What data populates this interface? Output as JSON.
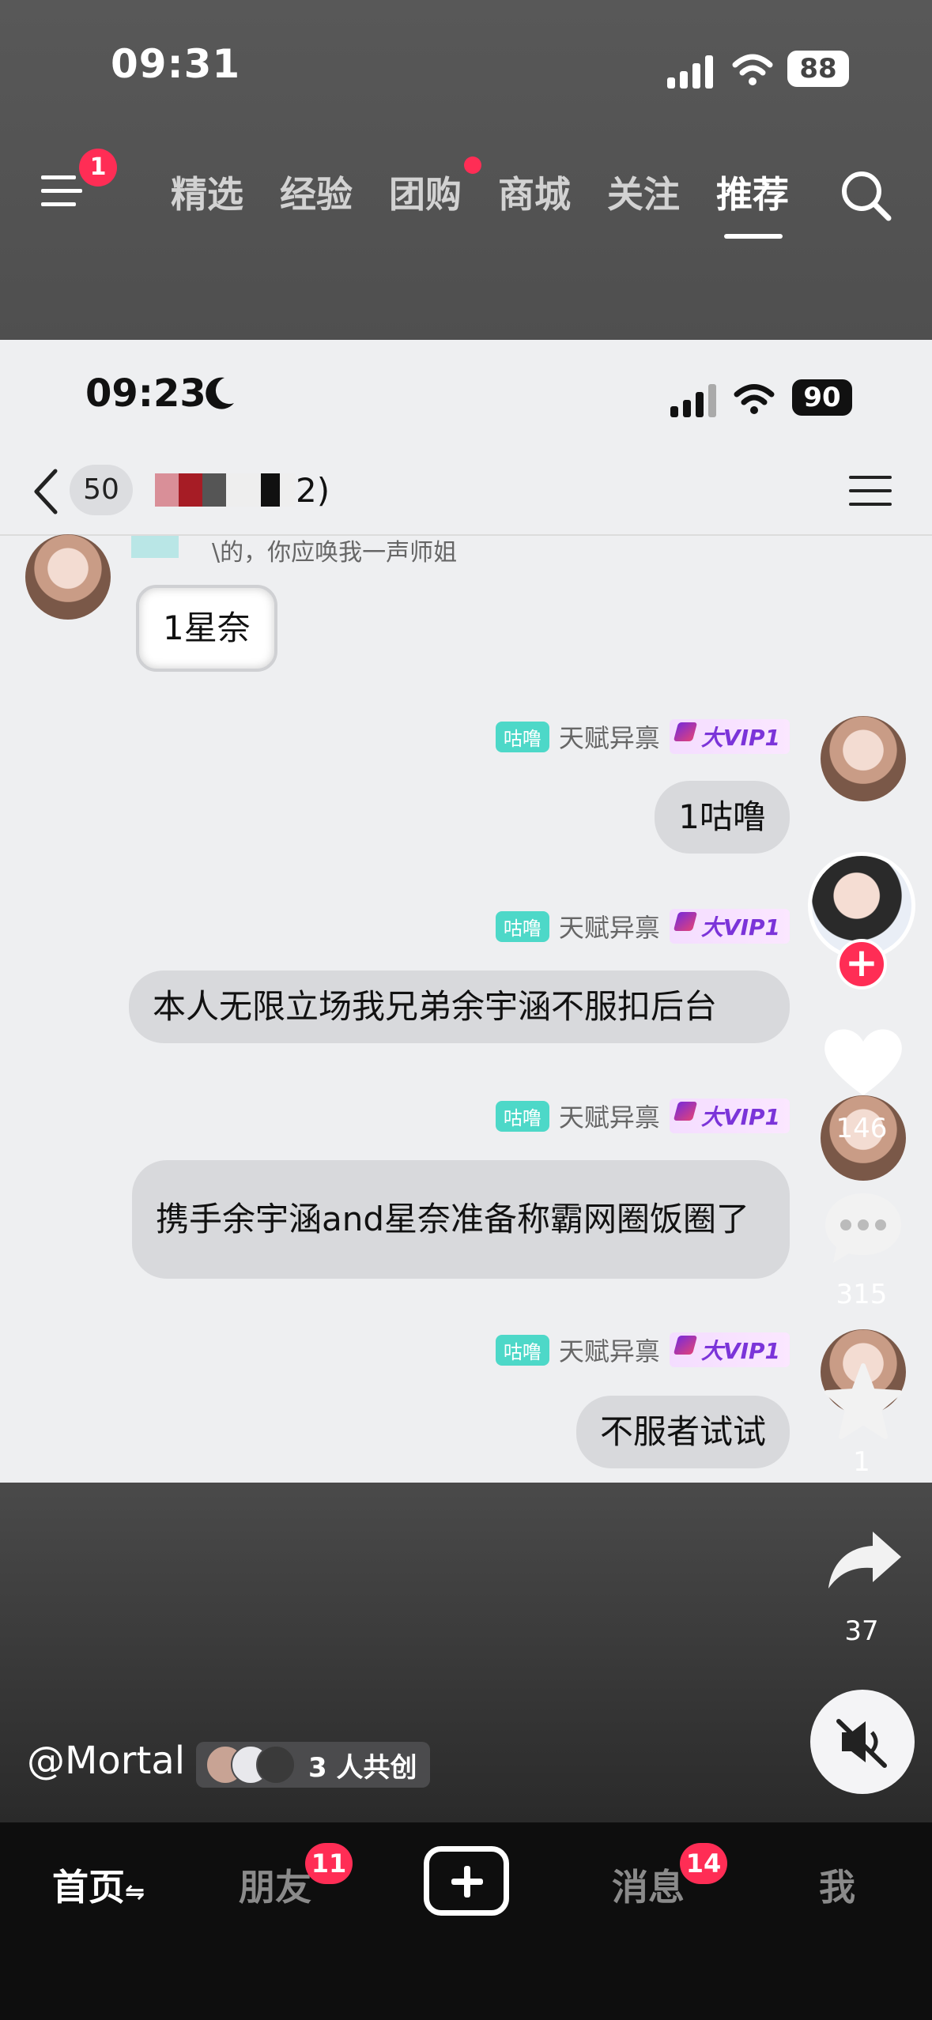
{
  "outer_status": {
    "time": "09:31",
    "battery": "88"
  },
  "top_nav": {
    "menu_badge": "1",
    "tabs": [
      "精选",
      "经验",
      "团购",
      "商城",
      "关注",
      "推荐"
    ],
    "active_tab": "推荐"
  },
  "inner_status": {
    "time": "09:23",
    "battery": "90"
  },
  "chat_header": {
    "unread": "50",
    "title_suffix": "2)"
  },
  "messages": [
    {
      "side": "left",
      "partial_text": "\\的，你应唤我一声师姐",
      "text": "1星奈"
    },
    {
      "side": "right",
      "level": "咕噜",
      "name": "天赋异禀",
      "vip": "大VIP1",
      "text": "1咕噜"
    },
    {
      "side": "right",
      "level": "咕噜",
      "name": "天赋异禀",
      "vip": "大VIP1",
      "text": "本人无限立场我兄弟余宇涵不服扣后台"
    },
    {
      "side": "right",
      "level": "咕噜",
      "name": "天赋异禀",
      "vip": "大VIP1",
      "text": "携手余宇涵and星奈准备称霸网圈饭圈了"
    },
    {
      "side": "right",
      "level": "咕噜",
      "name": "天赋异禀",
      "vip": "大VIP1",
      "text": "不服者试试"
    }
  ],
  "side_rail": {
    "likes": "146",
    "comments": "315",
    "favorites": "1",
    "shares": "37"
  },
  "author": {
    "handle": "@Mortal",
    "cocreate": "3 人共创"
  },
  "bottom_tabs": {
    "home": "首页",
    "friends": "朋友",
    "friends_badge": "11",
    "messages": "消息",
    "messages_badge": "14",
    "me": "我"
  },
  "colors": {
    "badge_red": "#ff2d55",
    "level_teal": "#4dd8c8",
    "vip_purple": "#7b34d9"
  }
}
